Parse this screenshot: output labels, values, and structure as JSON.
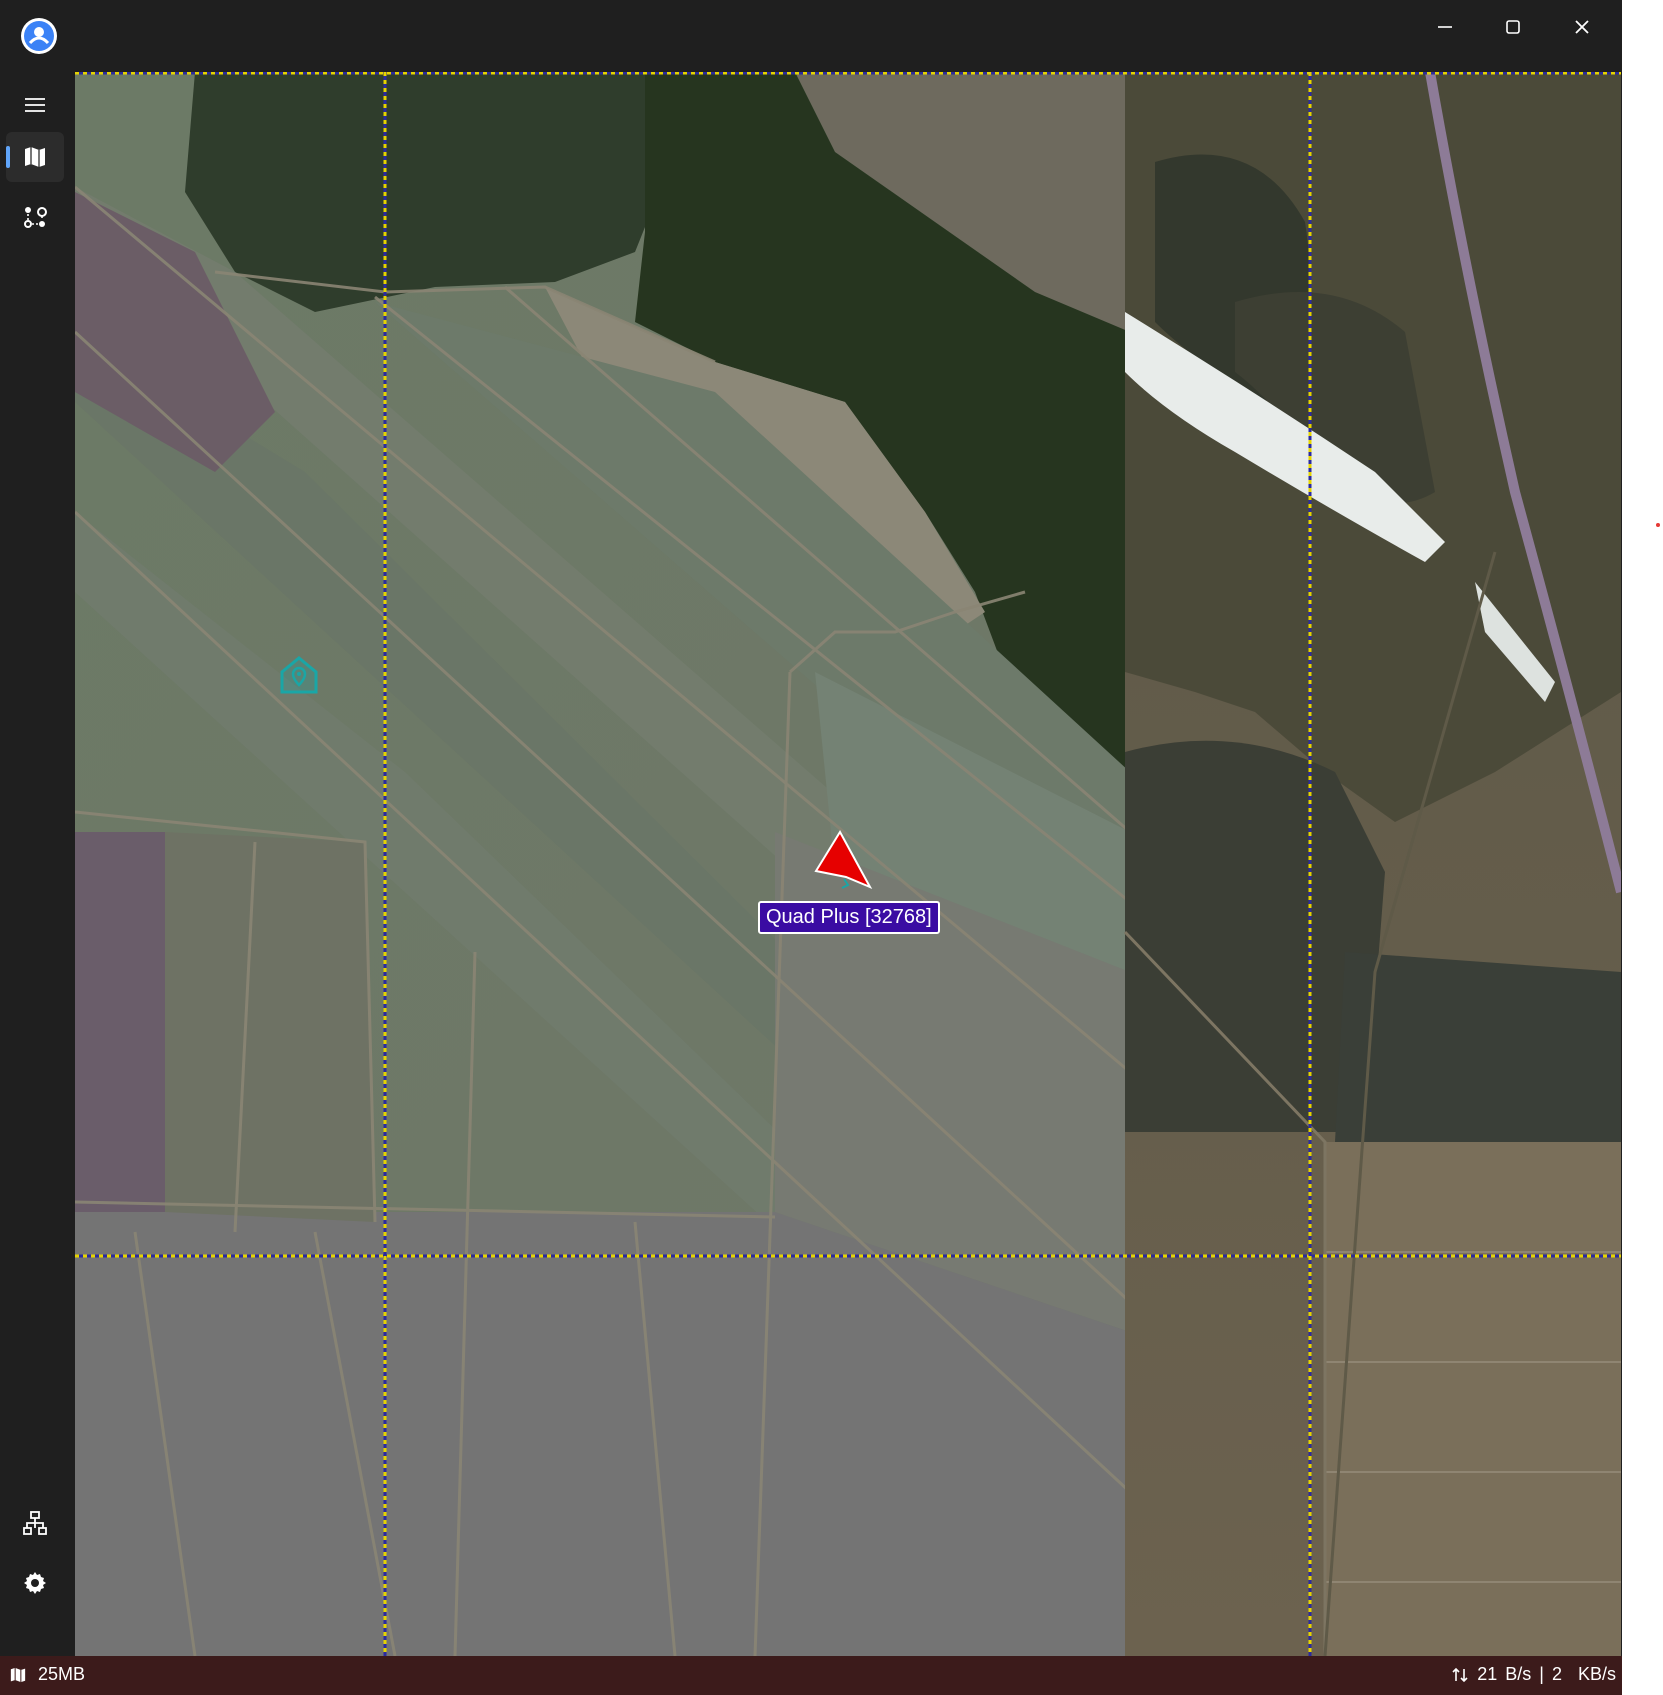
{
  "window": {
    "controls": {
      "minimize_icon": "minimize-icon",
      "maximize_icon": "maximize-icon",
      "close_icon": "close-icon"
    }
  },
  "sidebar": {
    "items": [
      {
        "icon": "menu-icon"
      },
      {
        "icon": "map-icon",
        "active": true
      },
      {
        "icon": "route-icon"
      },
      {
        "icon": "network-icon"
      },
      {
        "icon": "gear-icon"
      }
    ]
  },
  "map": {
    "vehicle": {
      "label": "Quad Plus [32768]",
      "color": "#e60000"
    },
    "home_marker": {
      "icon": "home-marker-icon",
      "color": "#1aa6a6"
    },
    "grid_line_colors": {
      "primary": "#2a2aa0",
      "secondary": "#e6d400"
    }
  },
  "statusbar": {
    "map_cache": "25MB",
    "rate_up_value": "21",
    "rate_up_unit": "B/s",
    "separator": "|",
    "rate_down_value": "2",
    "rate_down_unit": "KB/s"
  }
}
